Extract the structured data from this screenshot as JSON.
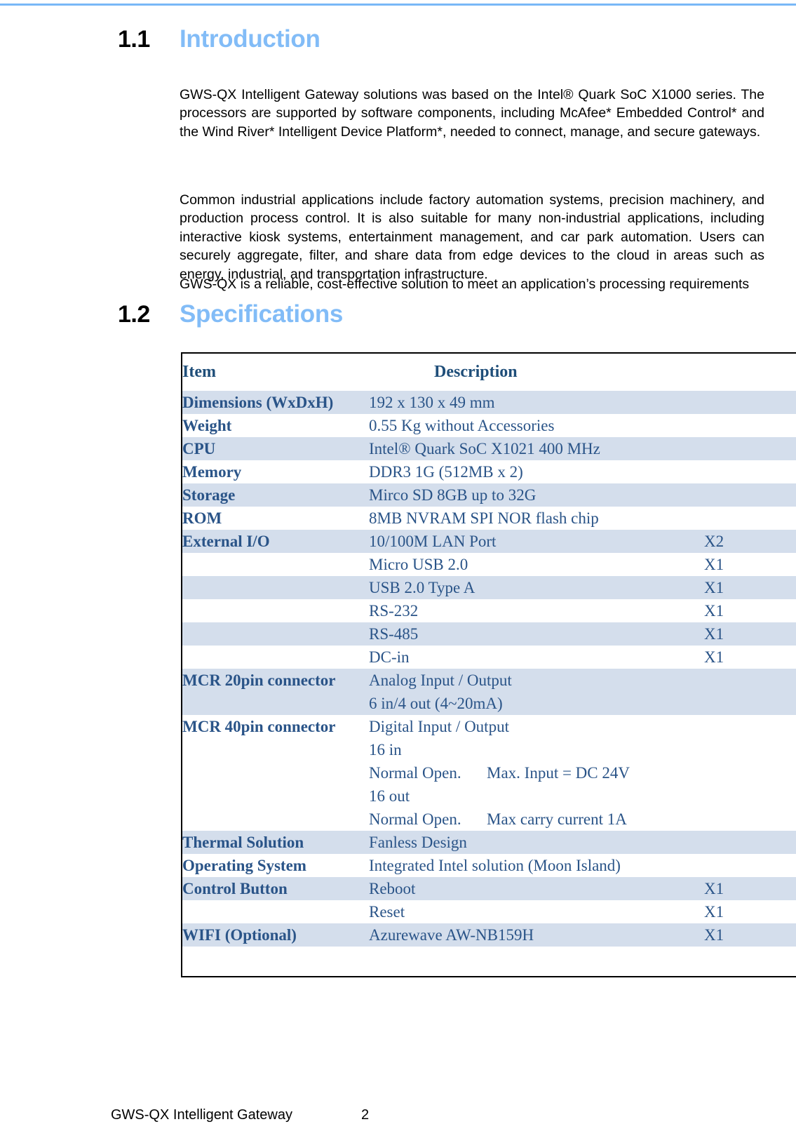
{
  "document": {
    "top_rule_color": "#79b8f7",
    "heading_color": "#82bcf7",
    "table_text_color": "#2a5488",
    "table_shade_color": "#d4deec"
  },
  "sections": {
    "introduction": {
      "number": "1.1",
      "title": "Introduction",
      "paragraph_1": "GWS-QX Intelligent Gateway solutions was based on the Intel® Quark SoC X1000 series. The processors are supported by software components, including McAfee* Embedded Control* and the Wind River* Intelligent Device Platform*, needed to connect, manage, and secure gateways.",
      "paragraph_2": "Common industrial applications include factory automation systems, precision machinery, and production process control. It is also suitable for many non-industrial applications, including interactive kiosk systems, entertainment management, and car park automation. Users can securely aggregate, filter, and share data from edge devices to the cloud in areas such as energy, industrial, and transportation infrastructure.",
      "paragraph_3": "GWS-QX is a reliable, cost-effective solution to meet an application’s processing requirements"
    },
    "specifications": {
      "number": "1.2",
      "title": "Specifications"
    }
  },
  "spec_table": {
    "headers": {
      "item": "Item",
      "description": "Description",
      "qty": ""
    },
    "rows": [
      {
        "item": "Dimensions (WxDxH)",
        "desc": "192 x 130 x 49 mm",
        "qty": "",
        "shaded": true
      },
      {
        "item": "Weight",
        "desc": "0.55 Kg without Accessories",
        "qty": "",
        "shaded": false
      },
      {
        "item": "CPU",
        "desc": "Intel® Quark SoC X1021 400 MHz",
        "qty": "",
        "shaded": true
      },
      {
        "item": "Memory",
        "desc": "DDR3 1G (512MB x 2)",
        "qty": "",
        "shaded": false
      },
      {
        "item": "Storage",
        "desc": "Mirco SD 8GB up to 32G",
        "qty": "",
        "shaded": true
      },
      {
        "item": "ROM",
        "desc": "8MB NVRAM SPI NOR flash chip",
        "qty": "",
        "shaded": false
      },
      {
        "item": "External I/O",
        "desc": "10/100M LAN Port",
        "qty": "X2",
        "shaded": true
      },
      {
        "item": "",
        "desc": "Micro USB 2.0",
        "qty": "X1",
        "shaded": false
      },
      {
        "item": "",
        "desc": "USB 2.0 Type A",
        "qty": "X1",
        "shaded": true
      },
      {
        "item": "",
        "desc": "RS-232",
        "qty": "X1",
        "shaded": false
      },
      {
        "item": "",
        "desc": "RS-485",
        "qty": "X1",
        "shaded": true
      },
      {
        "item": "",
        "desc": "DC-in",
        "qty": "X1",
        "shaded": false
      },
      {
        "item": "MCR 20pin connector",
        "desc_lines": [
          "Analog Input / Output",
          "6 in/4 out (4~20mA)"
        ],
        "qty": "",
        "shaded": true
      },
      {
        "item": "MCR 40pin connector",
        "desc_lines": [
          "Digital Input / Output",
          "16 in"
        ],
        "desc_pairs": [
          [
            "Normal Open.",
            "Max. Input = DC 24V"
          ],
          [
            "16 out",
            ""
          ],
          [
            "Normal Open.",
            "Max carry current 1A"
          ]
        ],
        "qty": "",
        "shaded": false
      },
      {
        "item": "Thermal Solution",
        "desc": "Fanless Design",
        "qty": "",
        "shaded": true
      },
      {
        "item": "Operating System",
        "desc": "Integrated Intel solution (Moon Island)",
        "qty": "",
        "shaded": false
      },
      {
        "item": "Control Button",
        "desc": "Reboot",
        "qty": "X1",
        "shaded": true
      },
      {
        "item": "",
        "desc": "Reset",
        "qty": "X1",
        "shaded": false
      },
      {
        "item": "WIFI    (Optional)",
        "desc": "Azurewave    AW-NB159H",
        "qty": "X1",
        "shaded": true
      },
      {
        "item": "",
        "desc": "",
        "qty": "",
        "shaded": false,
        "blank": true
      }
    ]
  },
  "footer": {
    "left": "GWS-QX Intelligent Gateway",
    "page_number": "2"
  }
}
